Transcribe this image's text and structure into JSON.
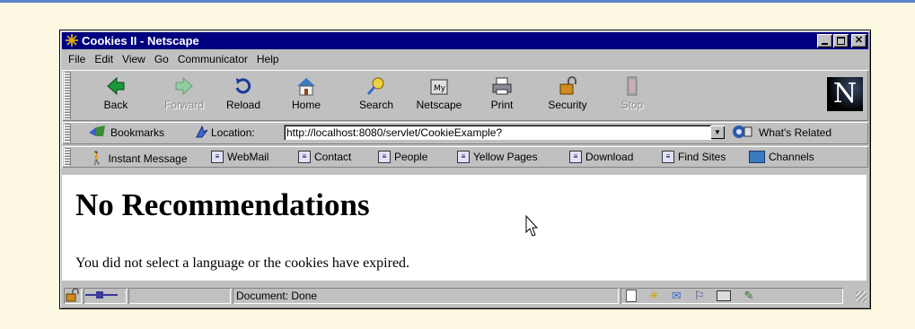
{
  "window": {
    "title": "Cookies II - Netscape"
  },
  "menu": [
    "File",
    "Edit",
    "View",
    "Go",
    "Communicator",
    "Help"
  ],
  "nav_buttons": [
    {
      "label": "Back",
      "icon": "back-arrow-icon",
      "enabled": true
    },
    {
      "label": "Forward",
      "icon": "forward-arrow-icon",
      "enabled": false
    },
    {
      "label": "Reload",
      "icon": "reload-icon",
      "enabled": true
    },
    {
      "label": "Home",
      "icon": "home-icon",
      "enabled": true
    },
    {
      "label": "Search",
      "icon": "search-icon",
      "enabled": true
    },
    {
      "label": "Netscape",
      "icon": "netscape-icon",
      "enabled": true
    },
    {
      "label": "Print",
      "icon": "print-icon",
      "enabled": true
    },
    {
      "label": "Security",
      "icon": "lock-icon",
      "enabled": true
    },
    {
      "label": "Stop",
      "icon": "stop-icon",
      "enabled": false
    }
  ],
  "location": {
    "bookmarks_label": "Bookmarks",
    "location_label": "Location:",
    "url": "http://localhost:8080/servlet/CookieExample?",
    "whats_related": "What's Related"
  },
  "personal": [
    "Instant Message",
    "WebMail",
    "Contact",
    "People",
    "Yellow Pages",
    "Download",
    "Find Sites",
    "Channels"
  ],
  "page": {
    "heading": "No Recommendations",
    "message": "You did not select a language or the cookies have expired."
  },
  "status": {
    "text": "Document: Done"
  }
}
